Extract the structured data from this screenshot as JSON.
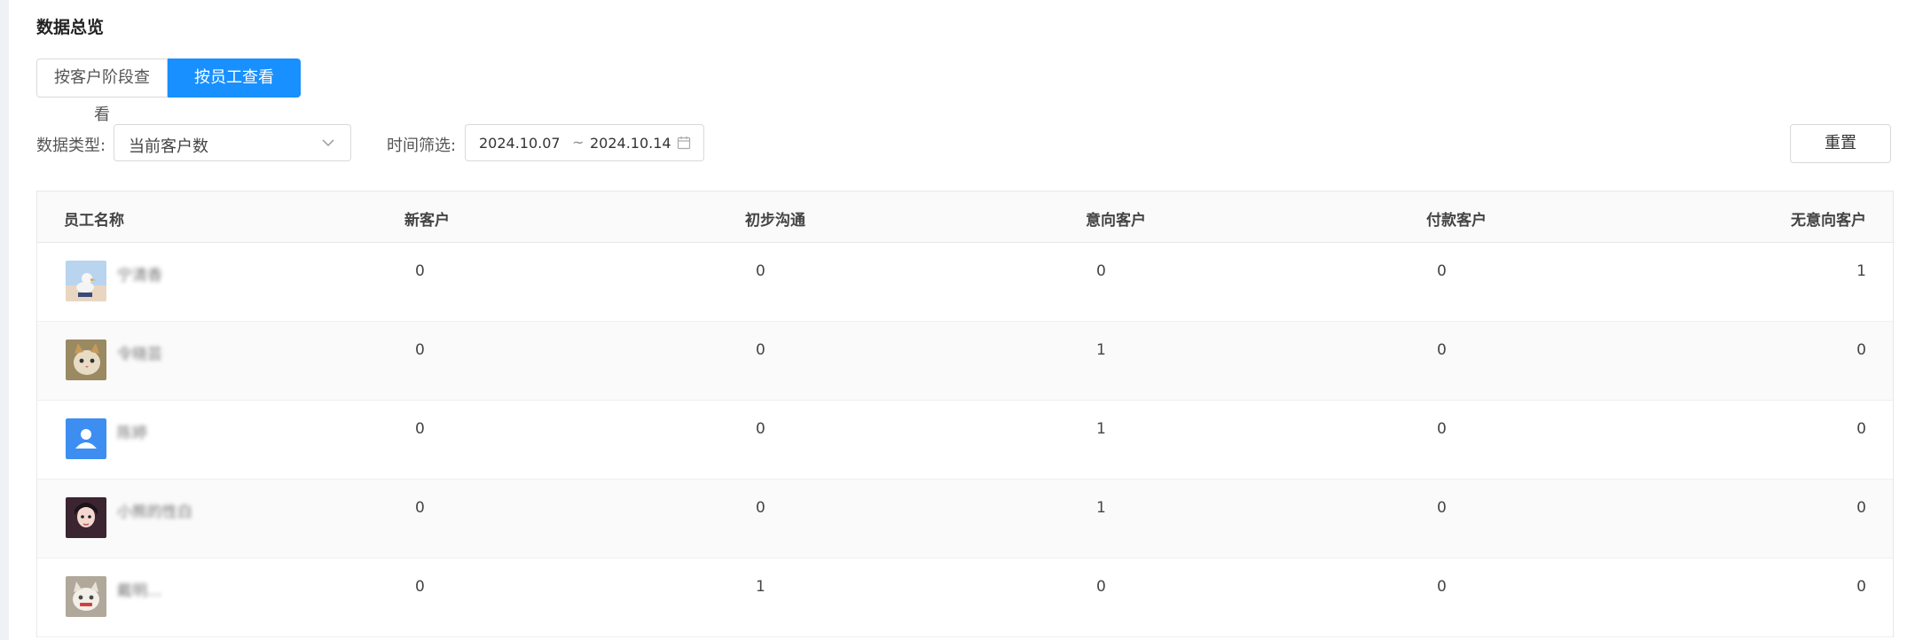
{
  "page": {
    "title": "数据总览"
  },
  "view_toggle": {
    "by_stage": "按客户阶段查看",
    "by_employee": "按员工查看",
    "active": "by_employee"
  },
  "filters": {
    "data_type_label": "数据类型:",
    "data_type_value": "当前客户数",
    "time_label": "时间筛选:",
    "date_start": "2024.10.07",
    "date_sep": "~",
    "date_end": "2024.10.14",
    "reset_label": "重置"
  },
  "table": {
    "columns": [
      "员工名称",
      "新客户",
      "初步沟通",
      "意向客户",
      "付款客户",
      "无意向客户"
    ],
    "rows": [
      {
        "name": "宁清香",
        "avatar_icon": "avatar-photo-duck",
        "values": [
          "0",
          "0",
          "0",
          "0",
          "1"
        ]
      },
      {
        "name": "令晓芸",
        "avatar_icon": "avatar-photo-cat",
        "values": [
          "0",
          "0",
          "1",
          "0",
          "0"
        ]
      },
      {
        "name": "陈婷",
        "avatar_icon": "avatar-default-user",
        "values": [
          "0",
          "0",
          "1",
          "0",
          "0"
        ]
      },
      {
        "name": "小熊的性白",
        "avatar_icon": "avatar-photo-girl",
        "values": [
          "0",
          "0",
          "1",
          "0",
          "0"
        ]
      },
      {
        "name": "戴明...",
        "avatar_icon": "avatar-photo-kitten",
        "values": [
          "0",
          "1",
          "0",
          "0",
          "0"
        ]
      }
    ]
  },
  "colors": {
    "accent": "#1890ff",
    "border": "#d9d9d9",
    "row_alt": "#fafafa"
  }
}
